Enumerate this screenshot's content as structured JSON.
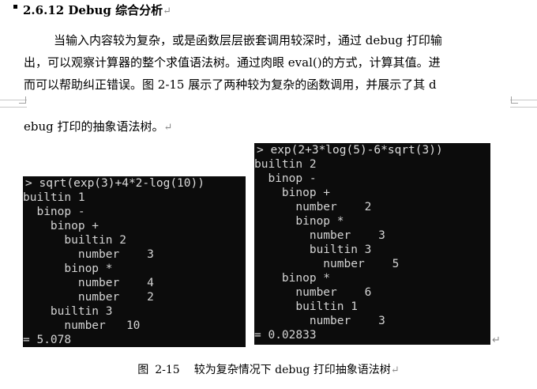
{
  "heading": {
    "text": "2.6.12 Debug 综合分析",
    "mark": "↵"
  },
  "paragraph": {
    "line1": "当输入内容较为复杂，或是函数层层嵌套调用较深时，通过 debug 打印输",
    "line2": "出，可以观察计算器的整个求值语法树。通过肉眼 eval()的方式，计算其值。进",
    "line3": "而可以帮助纠正错误。图  2-15 展示了两种较为复杂的函数调用，并展示了其 d",
    "line4": "ebug 打印的抽象语法树。",
    "mark": "↵"
  },
  "consoles": {
    "left": {
      "lines": [
        "> sqrt(exp(3)+4*2-log(10))",
        "builtin 1",
        "  binop -",
        "    binop +",
        "      builtin 2",
        "        number    3",
        "      binop *",
        "        number    4",
        "        number    2",
        "    builtin 3",
        "      number   10",
        "= 5.078"
      ]
    },
    "right": {
      "lines": [
        "> exp(2+3*log(5)-6*sqrt(3))",
        "builtin 2",
        "  binop -",
        "    binop +",
        "      number    2",
        "      binop *",
        "        number    3",
        "        builtin 3",
        "          number    5",
        "    binop *",
        "      number    6",
        "      builtin 1",
        "        number    3",
        "= 0.02833"
      ]
    }
  },
  "figure_mark": "↵",
  "caption": {
    "label": "图",
    "number": "2-15",
    "text": "较为复杂情况下 debug 打印抽象语法树",
    "mark": "↵"
  }
}
